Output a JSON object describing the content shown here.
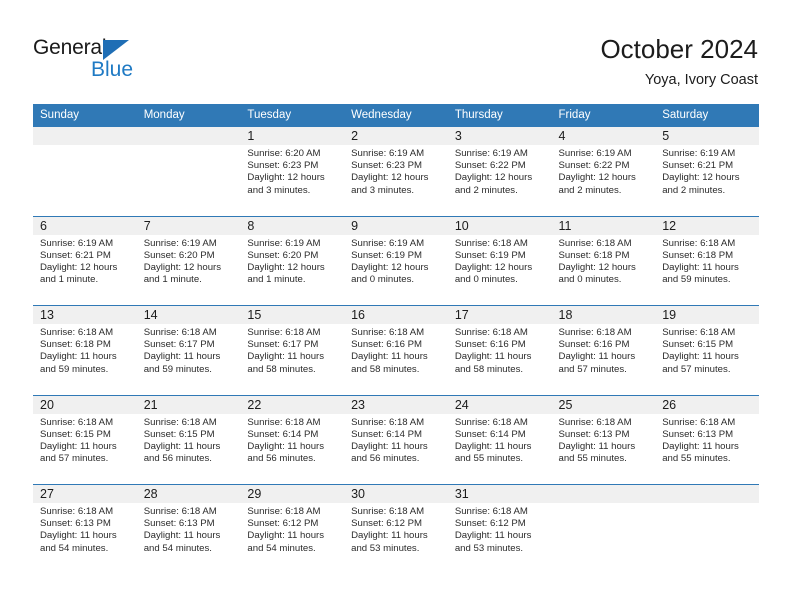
{
  "logo": {
    "word_top": "General",
    "word_bottom": "Blue",
    "triangle_icon": "triangle-icon",
    "brand_blue": "#1f7ac4",
    "brand_dark": "#1a1a1a"
  },
  "header": {
    "title": "October 2024",
    "subtitle": "Yoya, Ivory Coast"
  },
  "theme": {
    "header_blue": "#3079b6",
    "day_band_gray": "#f0f0f0",
    "text_dark": "#1c1c1c"
  },
  "day_headers": [
    "Sunday",
    "Monday",
    "Tuesday",
    "Wednesday",
    "Thursday",
    "Friday",
    "Saturday"
  ],
  "weeks": [
    [
      {
        "day": "",
        "empty": true,
        "lines": []
      },
      {
        "day": "",
        "empty": true,
        "lines": []
      },
      {
        "day": "1",
        "lines": [
          "Sunrise: 6:20 AM",
          "Sunset: 6:23 PM",
          "Daylight: 12 hours",
          "and 3 minutes."
        ]
      },
      {
        "day": "2",
        "lines": [
          "Sunrise: 6:19 AM",
          "Sunset: 6:23 PM",
          "Daylight: 12 hours",
          "and 3 minutes."
        ]
      },
      {
        "day": "3",
        "lines": [
          "Sunrise: 6:19 AM",
          "Sunset: 6:22 PM",
          "Daylight: 12 hours",
          "and 2 minutes."
        ]
      },
      {
        "day": "4",
        "lines": [
          "Sunrise: 6:19 AM",
          "Sunset: 6:22 PM",
          "Daylight: 12 hours",
          "and 2 minutes."
        ]
      },
      {
        "day": "5",
        "lines": [
          "Sunrise: 6:19 AM",
          "Sunset: 6:21 PM",
          "Daylight: 12 hours",
          "and 2 minutes."
        ]
      }
    ],
    [
      {
        "day": "6",
        "lines": [
          "Sunrise: 6:19 AM",
          "Sunset: 6:21 PM",
          "Daylight: 12 hours",
          "and 1 minute."
        ]
      },
      {
        "day": "7",
        "lines": [
          "Sunrise: 6:19 AM",
          "Sunset: 6:20 PM",
          "Daylight: 12 hours",
          "and 1 minute."
        ]
      },
      {
        "day": "8",
        "lines": [
          "Sunrise: 6:19 AM",
          "Sunset: 6:20 PM",
          "Daylight: 12 hours",
          "and 1 minute."
        ]
      },
      {
        "day": "9",
        "lines": [
          "Sunrise: 6:19 AM",
          "Sunset: 6:19 PM",
          "Daylight: 12 hours",
          "and 0 minutes."
        ]
      },
      {
        "day": "10",
        "lines": [
          "Sunrise: 6:18 AM",
          "Sunset: 6:19 PM",
          "Daylight: 12 hours",
          "and 0 minutes."
        ]
      },
      {
        "day": "11",
        "lines": [
          "Sunrise: 6:18 AM",
          "Sunset: 6:18 PM",
          "Daylight: 12 hours",
          "and 0 minutes."
        ]
      },
      {
        "day": "12",
        "lines": [
          "Sunrise: 6:18 AM",
          "Sunset: 6:18 PM",
          "Daylight: 11 hours",
          "and 59 minutes."
        ]
      }
    ],
    [
      {
        "day": "13",
        "lines": [
          "Sunrise: 6:18 AM",
          "Sunset: 6:18 PM",
          "Daylight: 11 hours",
          "and 59 minutes."
        ]
      },
      {
        "day": "14",
        "lines": [
          "Sunrise: 6:18 AM",
          "Sunset: 6:17 PM",
          "Daylight: 11 hours",
          "and 59 minutes."
        ]
      },
      {
        "day": "15",
        "lines": [
          "Sunrise: 6:18 AM",
          "Sunset: 6:17 PM",
          "Daylight: 11 hours",
          "and 58 minutes."
        ]
      },
      {
        "day": "16",
        "lines": [
          "Sunrise: 6:18 AM",
          "Sunset: 6:16 PM",
          "Daylight: 11 hours",
          "and 58 minutes."
        ]
      },
      {
        "day": "17",
        "lines": [
          "Sunrise: 6:18 AM",
          "Sunset: 6:16 PM",
          "Daylight: 11 hours",
          "and 58 minutes."
        ]
      },
      {
        "day": "18",
        "lines": [
          "Sunrise: 6:18 AM",
          "Sunset: 6:16 PM",
          "Daylight: 11 hours",
          "and 57 minutes."
        ]
      },
      {
        "day": "19",
        "lines": [
          "Sunrise: 6:18 AM",
          "Sunset: 6:15 PM",
          "Daylight: 11 hours",
          "and 57 minutes."
        ]
      }
    ],
    [
      {
        "day": "20",
        "lines": [
          "Sunrise: 6:18 AM",
          "Sunset: 6:15 PM",
          "Daylight: 11 hours",
          "and 57 minutes."
        ]
      },
      {
        "day": "21",
        "lines": [
          "Sunrise: 6:18 AM",
          "Sunset: 6:15 PM",
          "Daylight: 11 hours",
          "and 56 minutes."
        ]
      },
      {
        "day": "22",
        "lines": [
          "Sunrise: 6:18 AM",
          "Sunset: 6:14 PM",
          "Daylight: 11 hours",
          "and 56 minutes."
        ]
      },
      {
        "day": "23",
        "lines": [
          "Sunrise: 6:18 AM",
          "Sunset: 6:14 PM",
          "Daylight: 11 hours",
          "and 56 minutes."
        ]
      },
      {
        "day": "24",
        "lines": [
          "Sunrise: 6:18 AM",
          "Sunset: 6:14 PM",
          "Daylight: 11 hours",
          "and 55 minutes."
        ]
      },
      {
        "day": "25",
        "lines": [
          "Sunrise: 6:18 AM",
          "Sunset: 6:13 PM",
          "Daylight: 11 hours",
          "and 55 minutes."
        ]
      },
      {
        "day": "26",
        "lines": [
          "Sunrise: 6:18 AM",
          "Sunset: 6:13 PM",
          "Daylight: 11 hours",
          "and 55 minutes."
        ]
      }
    ],
    [
      {
        "day": "27",
        "lines": [
          "Sunrise: 6:18 AM",
          "Sunset: 6:13 PM",
          "Daylight: 11 hours",
          "and 54 minutes."
        ]
      },
      {
        "day": "28",
        "lines": [
          "Sunrise: 6:18 AM",
          "Sunset: 6:13 PM",
          "Daylight: 11 hours",
          "and 54 minutes."
        ]
      },
      {
        "day": "29",
        "lines": [
          "Sunrise: 6:18 AM",
          "Sunset: 6:12 PM",
          "Daylight: 11 hours",
          "and 54 minutes."
        ]
      },
      {
        "day": "30",
        "lines": [
          "Sunrise: 6:18 AM",
          "Sunset: 6:12 PM",
          "Daylight: 11 hours",
          "and 53 minutes."
        ]
      },
      {
        "day": "31",
        "lines": [
          "Sunrise: 6:18 AM",
          "Sunset: 6:12 PM",
          "Daylight: 11 hours",
          "and 53 minutes."
        ]
      },
      {
        "day": "",
        "empty": true,
        "lines": []
      },
      {
        "day": "",
        "empty": true,
        "lines": []
      }
    ]
  ]
}
